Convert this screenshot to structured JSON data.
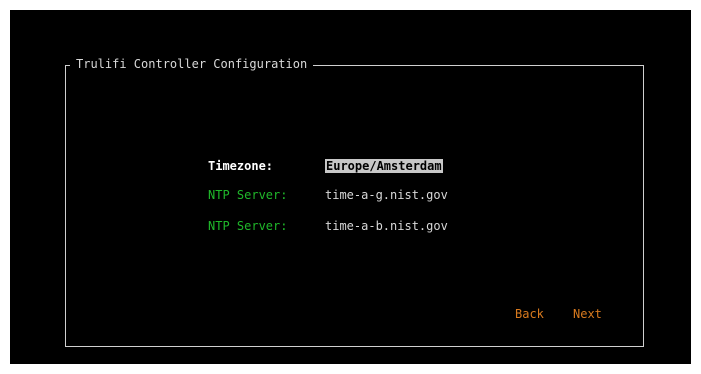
{
  "dialog": {
    "title": "Trulifi Controller Configuration"
  },
  "fields": [
    {
      "label": "Timezone:",
      "value": "Europe/Amsterdam"
    },
    {
      "label": "NTP Server:",
      "value": "time-a-g.nist.gov"
    },
    {
      "label": "NTP Server:",
      "value": "time-a-b.nist.gov"
    }
  ],
  "buttons": {
    "back_label": "Back",
    "next_label": "Next"
  },
  "colors": {
    "background": "#000000",
    "frame": "#d0d0d0",
    "active_label": "#ffffff",
    "inactive_label": "#1fb82a",
    "button": "#d97a1e",
    "focus_highlight": "#c8c8c8"
  }
}
